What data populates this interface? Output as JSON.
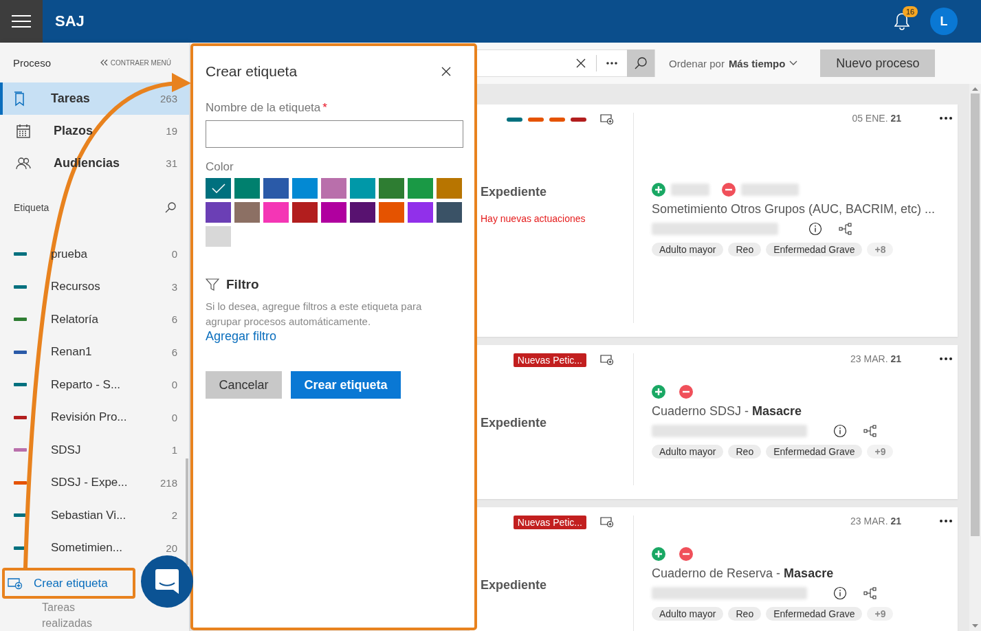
{
  "topbar": {
    "app_name": "SAJ",
    "notification_count": "16",
    "avatar_initial": "L"
  },
  "sidebar": {
    "heading": "Proceso",
    "collapse_label": "CONTRAER MENÚ",
    "nav": [
      {
        "kind": "tasks",
        "label": "Tareas",
        "count": "263",
        "selected": true
      },
      {
        "kind": "calendar",
        "label": "Plazos",
        "count": "19",
        "selected": false
      },
      {
        "kind": "people",
        "label": "Audiencias",
        "count": "31",
        "selected": false
      }
    ],
    "labels_heading": "Etiqueta",
    "labels": [
      {
        "name": "prueba",
        "count": "0",
        "color": "#00707e"
      },
      {
        "name": "Recursos",
        "count": "3",
        "color": "#00707e"
      },
      {
        "name": "Relatoría",
        "count": "6",
        "color": "#2e7d32"
      },
      {
        "name": "Renan1",
        "count": "6",
        "color": "#2a5aa8"
      },
      {
        "name": "Reparto - S...",
        "count": "0",
        "color": "#00707e"
      },
      {
        "name": "Revisión Pro...",
        "count": "0",
        "color": "#b21e1e"
      },
      {
        "name": "SDSJ",
        "count": "1",
        "color": "#b96fab"
      },
      {
        "name": "SDSJ - Expe...",
        "count": "218",
        "color": "#e55300"
      },
      {
        "name": "Sebastian Vi...",
        "count": "2",
        "color": "#00707e"
      },
      {
        "name": "Sometimien...",
        "count": "20",
        "color": "#00707e"
      }
    ],
    "create_link": "Crear etiqueta",
    "footer": "Tareas realizadas"
  },
  "toolbar": {
    "sort_label": "Ordenar por",
    "sort_value": "Más tiempo",
    "new_button": "Nuevo proceso"
  },
  "cards": [
    {
      "label_bars": [
        {
          "color": "#00707e"
        },
        {
          "color": "#e55300"
        },
        {
          "color": "#e55300"
        },
        {
          "color": "#b21e1e"
        }
      ],
      "type_label": "Expediente",
      "notice": "Hay nuevas actuaciones",
      "date": "05 ENE. **21**",
      "redacted_parties": true,
      "title": "Sometimiento Otros Grupos (AUC, BACRIM, etc) ...",
      "tags": [
        "Adulto mayor",
        "Reo",
        "Enfermedad Grave"
      ],
      "more_tags": "+8"
    },
    {
      "badge": "Nuevas Petic...",
      "type_label": "Expediente",
      "date": "23 MAR. **21**",
      "redacted_parties": false,
      "title": "Cuaderno SDSJ - **Masacre**",
      "tags": [
        "Adulto mayor",
        "Reo",
        "Enfermedad Grave"
      ],
      "more_tags": "+9"
    },
    {
      "badge": "Nuevas Petic...",
      "type_label": "Expediente",
      "date": "23 MAR. **21**",
      "redacted_parties": false,
      "title": "Cuaderno de Reserva - **Masacre**",
      "tags": [
        "Adulto mayor",
        "Reo",
        "Enfermedad Grave"
      ],
      "more_tags": "+9"
    }
  ],
  "dialog": {
    "title": "Crear etiqueta",
    "name_label": "Nombre de la etiqueta",
    "required_mark": "*",
    "color_label": "Color",
    "colors": [
      {
        "color": "#00707e",
        "selected": true
      },
      {
        "color": "#00806e",
        "selected": false
      },
      {
        "color": "#2a5aa8",
        "selected": false
      },
      {
        "color": "#0389d3",
        "selected": false
      },
      {
        "color": "#b96fab",
        "selected": false
      },
      {
        "color": "#0098a8",
        "selected": false
      },
      {
        "color": "#2e7d32",
        "selected": false
      },
      {
        "color": "#1a9945",
        "selected": false
      },
      {
        "color": "#b87500",
        "selected": false
      },
      {
        "color": "#6b3fb5",
        "selected": false
      },
      {
        "color": "#8c7064",
        "selected": false
      },
      {
        "color": "#f436b5",
        "selected": false
      },
      {
        "color": "#b21e1e",
        "selected": false
      },
      {
        "color": "#b0009f",
        "selected": false
      },
      {
        "color": "#581270",
        "selected": false
      },
      {
        "color": "#e55300",
        "selected": false
      },
      {
        "color": "#9130ea",
        "selected": false
      },
      {
        "color": "#3a5266",
        "selected": false
      },
      {
        "color": "#d8d8d8",
        "selected": false
      }
    ],
    "filter_title": "Filtro",
    "filter_text": "Si lo desea, agregue filtros a este etiqueta para agrupar procesos automáticamente.",
    "filter_link": "Agregar filtro",
    "cancel_button": "Cancelar",
    "create_button": "Crear etiqueta"
  }
}
